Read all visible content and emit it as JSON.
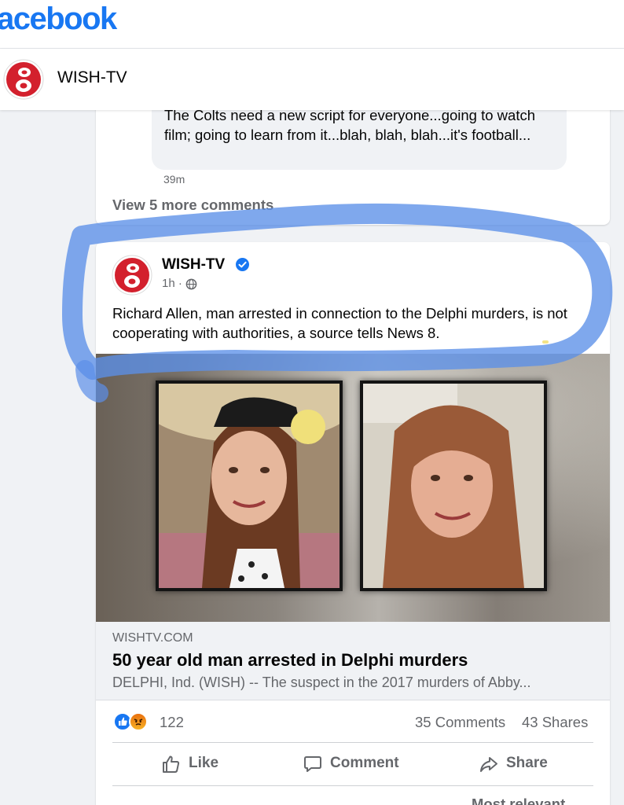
{
  "app": {
    "brand": "acebook"
  },
  "page_header": {
    "name": "WISH-TV"
  },
  "previous_post": {
    "comment_text": "The Colts need a new script for everyone...going to watch film; going to learn from it...blah, blah, blah...it's football...",
    "comment_time": "39m",
    "view_more": "View 5 more comments"
  },
  "post": {
    "author": "WISH-TV",
    "time": "1h ·",
    "text_before": "Richard Allen, man arrested in connection to the Delphi murders, is ",
    "text_highlight": "not cooperating with authorities,",
    "text_after": " a source tells News 8.",
    "link": {
      "domain": "WISHTV.COM",
      "title": "50 year old man arrested in Delphi murders",
      "description": "DELPHI, Ind. (WISH) -- The suspect in the 2017 murders of Abby..."
    },
    "reaction_count": "122",
    "comments_count": "35 Comments",
    "shares_count": "43 Shares",
    "actions": {
      "like": "Like",
      "comment": "Comment",
      "share": "Share"
    },
    "sort_label": "Most relevant ⌄"
  },
  "colors": {
    "facebook_blue": "#1877f2",
    "marker_blue": "#5b8fe8",
    "highlight_yellow": "#f2e07a",
    "wish_red": "#d3202d"
  },
  "icons": [
    "wish8-logo",
    "verified-badge-icon",
    "globe-icon",
    "like-reaction-icon",
    "angry-reaction-icon",
    "thumbs-up-icon",
    "comment-icon",
    "share-icon"
  ]
}
